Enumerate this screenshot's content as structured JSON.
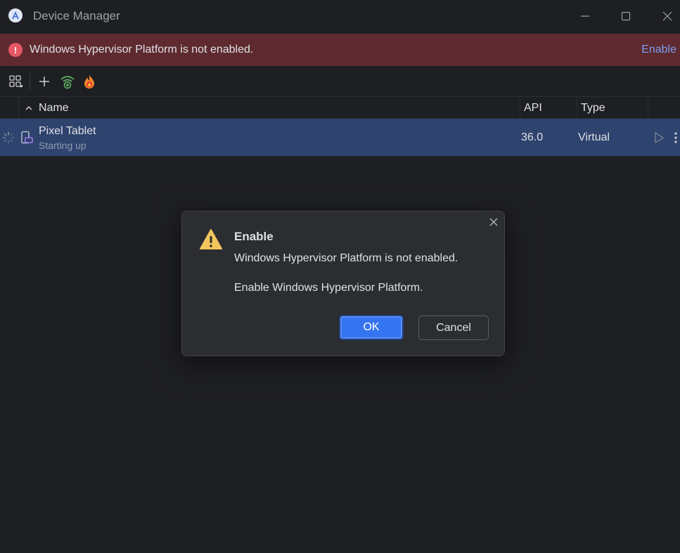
{
  "window": {
    "title": "Device Manager",
    "app_icon": "android-studio-icon",
    "controls": [
      "minimize-icon",
      "maximize-icon",
      "close-icon"
    ]
  },
  "banner": {
    "icon": "error-icon",
    "icon_glyph": "!",
    "message": "Windows Hypervisor Platform is not enabled.",
    "action_label": "Enable",
    "colors": {
      "background": "#5e2a2f",
      "link": "#7b9cf2",
      "icon": "#e55765"
    }
  },
  "toolbar": {
    "items": [
      "device-grid-icon",
      "add-icon",
      "wifi-pair-icon",
      "firebase-icon"
    ]
  },
  "table": {
    "columns": {
      "name": "Name",
      "api": "API",
      "type": "Type"
    },
    "sort_icon": "chevron-up-icon",
    "rows": [
      {
        "name": "Pixel Tablet",
        "status": "Starting up",
        "api": "36.0",
        "type": "Virtual",
        "icons": [
          "loading-spinner-icon",
          "tablet-icon",
          "play-icon",
          "more-vertical-icon"
        ]
      }
    ],
    "colors": {
      "selected_row": "#2e436e"
    }
  },
  "dialog": {
    "icon": "warning-icon",
    "title": "Enable",
    "message": "Windows Hypervisor Platform is not enabled.",
    "detail": "Enable Windows Hypervisor Platform.",
    "ok_label": "OK",
    "cancel_label": "Cancel",
    "colors": {
      "primary": "#3574f0",
      "warning": "#f2c55c"
    }
  }
}
